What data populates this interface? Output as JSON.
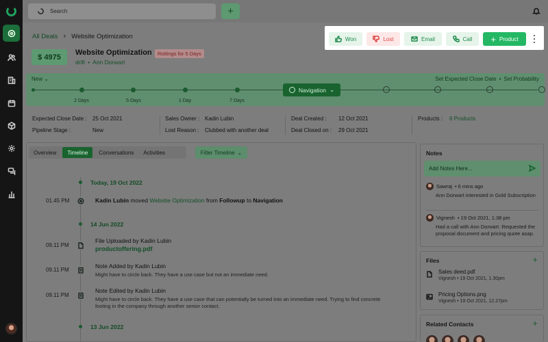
{
  "search": {
    "placeholder": "Search"
  },
  "breadcrumb": {
    "root": "All Deals",
    "current": "Website Optimization"
  },
  "actions": {
    "won": "Won",
    "lost": "Lost",
    "email": "Email",
    "call": "Call",
    "product": "Product"
  },
  "deal": {
    "price": "$ 4975",
    "title": "Website Optimization",
    "badge": "Rottings for 5 Days",
    "source": "drift",
    "bullet": "•",
    "contact": "Ann Dorwart"
  },
  "pipeline": {
    "stage_label": "New",
    "set_close": "Set Expected Close Date",
    "set_prob": "Set Probability",
    "bullet": "•",
    "current_stage": "Navigation",
    "labels": [
      "2 Days",
      "5 Days",
      "1 Day",
      "7 Days"
    ]
  },
  "info": {
    "close_date_label": "Expected Close Date :",
    "close_date": "25 Oct 2021",
    "stage_label": "Pipeline Stage :",
    "stage": "New",
    "owner_label": "Sales Owner :",
    "owner": "Kadin Lubin",
    "lost_label": "Lost Reason :",
    "lost": "Clubbed with another deal",
    "created_label": "Deal Created :",
    "created": "12 Oct 2021",
    "closed_label": "Deal Closed on :",
    "closed": "29 Oct 2021",
    "products_label": "Products :",
    "products": "6 Products"
  },
  "tabs": [
    "Overview",
    "Timeline",
    "Conversations",
    "Activities"
  ],
  "filter": "Filter Timeline",
  "timeline": {
    "date1": "Today, 19 Oct 2022",
    "e1_time": "01.45 PM",
    "e1_actor": "Kadin Lubin",
    "e1_verb": "moved",
    "e1_deal": "Webstie Optimization",
    "e1_from": "from",
    "e1_a": "Followup",
    "e1_to": "to",
    "e1_b": "Navigation",
    "date2": "14 Jun 2022",
    "e2_time": "09.11 PM",
    "e2_text": "File Uploaded by Kadin Lubin",
    "e2_file": "productoffering.pdf",
    "e3_time": "09.11 PM",
    "e3_text": "Note Added by Kadin Lubin",
    "e3_sub": "Might have to circle back. They have a use case but not an immediate need.",
    "e4_time": "09.11 PM",
    "e4_text": "Note Edited by Kadin Lubin",
    "e4_sub": "Might have to circle back. They have a use case that can potentially be turned into an immediate need. Trying to find concrete footing in the company through another senior contact.",
    "date3": "13 Jun 2022"
  },
  "notes": {
    "title": "Notes",
    "placeholder": "Add Notes Here...",
    "n1_author": "Sawraj",
    "n1_time": "• 6 mins ago",
    "n1_body": "Ann Dorwart interested in Gold Subscription",
    "n2_author": "Vignesh",
    "n2_time": "• 19 Oct 2021, 1.38 pm",
    "n2_body": "Had a call with Ann Dorwart. Requested the proposal document and pricing quote asap."
  },
  "files": {
    "title": "Files",
    "f1_name": "Sales deed.pdf",
    "f1_meta": "Vignesh  •  19 Oct 2021, 1.30pm",
    "f2_name": "Pricing Options.png",
    "f2_meta": "Vignesh  •  19 Oct 2021, 12.27pm"
  },
  "contacts": {
    "title": "Related Contacts"
  },
  "colors": {
    "accent": "#24b864",
    "lost": "#dd4444",
    "sidebar": "#151515"
  }
}
